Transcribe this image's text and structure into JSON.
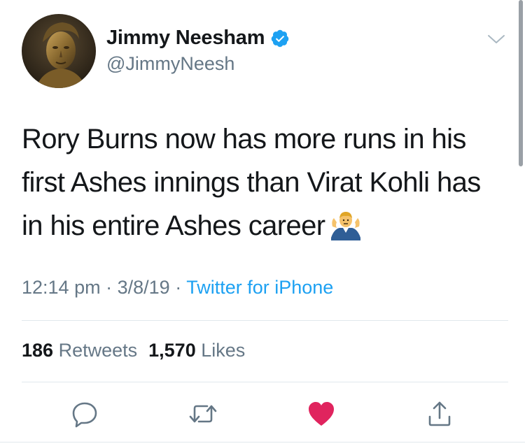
{
  "tweet": {
    "author": {
      "display_name": "Jimmy Neesham",
      "handle": "@JimmyNeesh",
      "verified": true,
      "avatar_icon": "bronze-bust-avatar"
    },
    "text": "Rory Burns now has more runs in his first Ashes innings than Virat Kohli has in his entire Ashes career",
    "text_lines": [
      "Rory Burns now has more runs in his",
      "first Ashes innings than Virat Kohli has",
      "in his entire Ashes career"
    ],
    "emoji": "man-shrugging-emoji",
    "time": "12:14 pm",
    "date": "3/8/19",
    "separator": "·",
    "source": "Twitter for iPhone",
    "stats": {
      "retweets_count": "186",
      "retweets_label": "Retweets",
      "likes_count": "1,570",
      "likes_label": "Likes"
    },
    "actions": [
      {
        "name": "reply-icon"
      },
      {
        "name": "retweet-icon"
      },
      {
        "name": "like-icon",
        "state": "liked"
      },
      {
        "name": "share-icon"
      }
    ]
  },
  "colors": {
    "text_primary": "#14171a",
    "text_secondary": "#657786",
    "link": "#1da1f2",
    "verified": "#1da1f2",
    "like": "#e0245e",
    "divider": "#e1e8ed"
  }
}
